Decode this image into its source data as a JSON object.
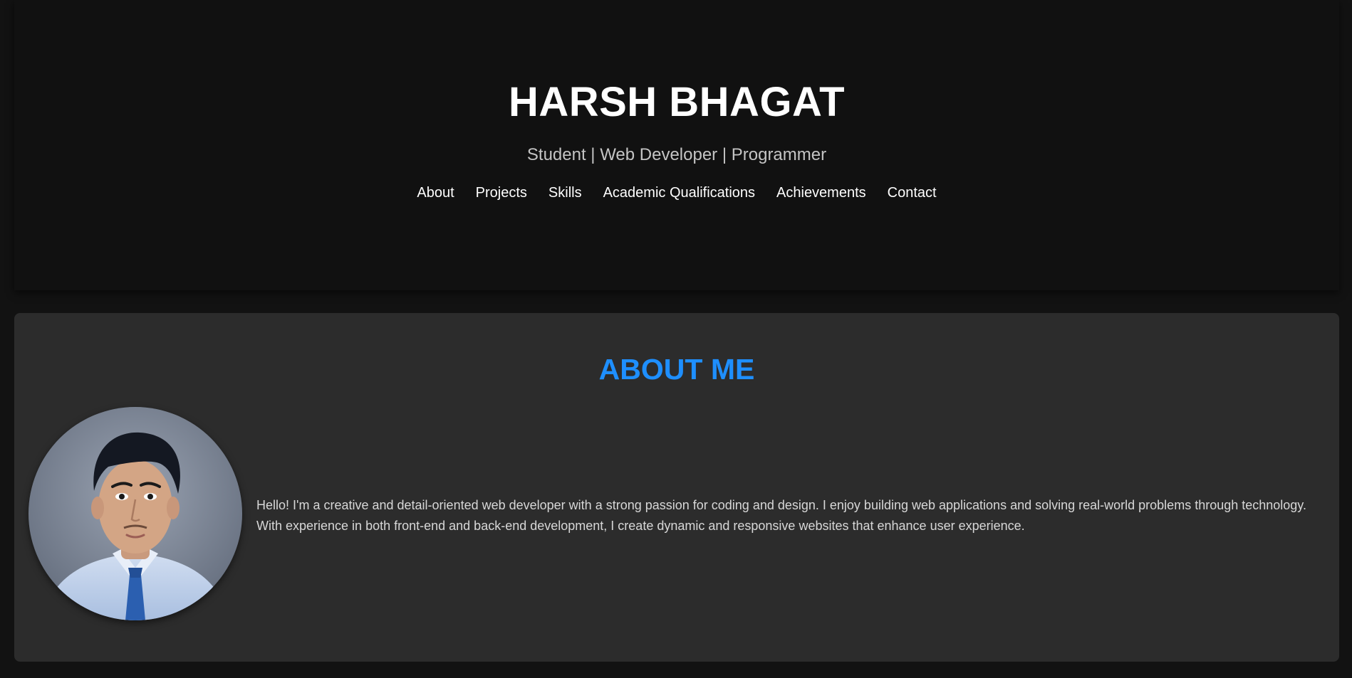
{
  "header": {
    "name": "HARSH BHAGAT",
    "tagline": "Student | Web Developer | Programmer",
    "nav": [
      {
        "label": "About"
      },
      {
        "label": "Projects"
      },
      {
        "label": "Skills"
      },
      {
        "label": "Academic Qualifications"
      },
      {
        "label": "Achievements"
      },
      {
        "label": "Contact"
      }
    ]
  },
  "about": {
    "title": "ABOUT ME",
    "text": "Hello! I'm a creative and detail-oriented web developer with a strong passion for coding and design. I enjoy building web applications and solving real-world problems through technology. With experience in both front-end and back-end development, I create dynamic and responsive websites that enhance user experience.",
    "photo_icon": "profile-photo"
  },
  "colors": {
    "background": "#121212",
    "header_bg": "#111111",
    "card_bg": "#2c2c2c",
    "accent": "#1e8fff",
    "text": "#ffffff",
    "muted": "#c4c4c4"
  }
}
